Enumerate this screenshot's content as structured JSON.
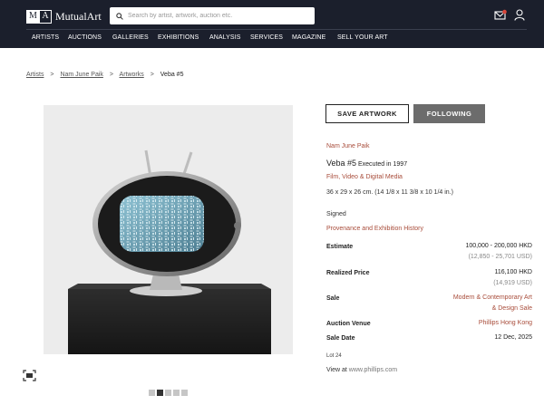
{
  "brand": {
    "monogram_left": "M",
    "monogram_right": "A",
    "name": "MutualArt"
  },
  "search": {
    "placeholder": "Search by artist, artwork, auction etc."
  },
  "header_icons": [
    "mail-notification-icon",
    "user-icon"
  ],
  "nav": [
    "ARTISTS",
    "AUCTIONS",
    "GALLERIES",
    "EXHIBITIONS",
    "ANALYSIS",
    "SERVICES",
    "MAGAZINE",
    "SELL YOUR ART"
  ],
  "breadcrumb": {
    "items": [
      "Artists",
      "Nam June Paik",
      "Artworks"
    ],
    "current": "Veba #5",
    "separator": ">"
  },
  "actions": {
    "save": "SAVE ARTWORK",
    "follow": "FOLLOWING"
  },
  "artwork": {
    "artist": "Nam June Paik",
    "title": "Veba #5",
    "executed": "Executed in 1997",
    "medium": "Film, Video & Digital Media",
    "dimensions": "36 x 29 x 26 cm. (14 1/8 x 11 3/8 x 10 1/4 in.)",
    "signed": "Signed",
    "provenance_link": "Provenance and Exhibition History"
  },
  "details": {
    "estimate_label": "Estimate",
    "estimate_value": "100,000 - 200,000 HKD",
    "estimate_usd": "(12,850 - 25,701 USD)",
    "realized_label": "Realized Price",
    "realized_value": "116,100 HKD",
    "realized_usd": "(14,919 USD)",
    "sale_label": "Sale",
    "sale_line1": "Modern & Contemporary Art",
    "sale_line2": "& Design Sale",
    "venue_label": "Auction Venue",
    "venue_value": "Phillips Hong Kong",
    "date_label": "Sale Date",
    "date_value": "12 Dec, 2025"
  },
  "lot": "Lot 24",
  "view_at": {
    "prefix": "View at",
    "host": "www.phillips.com"
  },
  "gallery": {
    "count": 5,
    "active_index": 1
  },
  "colors": {
    "header_bg": "#1b1f2c",
    "link_red": "#a84c3a",
    "following_bg": "#6c6c6c"
  }
}
